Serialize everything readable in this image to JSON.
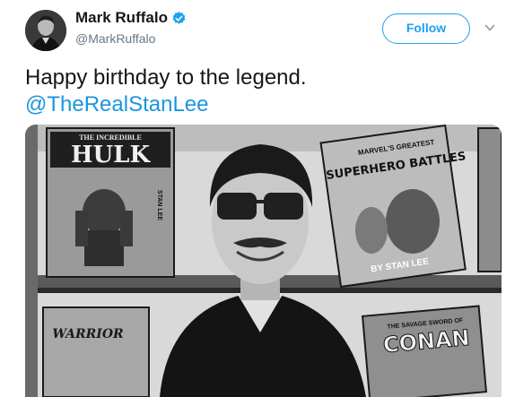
{
  "author": {
    "display_name": "Mark Ruffalo",
    "handle": "@MarkRuffalo",
    "verified": true
  },
  "actions": {
    "follow_label": "Follow",
    "menu_icon": "chevron-down-icon"
  },
  "tweet": {
    "text": "Happy birthday to the legend.",
    "mention": "@TheRealStanLee"
  },
  "media": {
    "comic_hulk_header": "THE INCREDIBLE",
    "comic_hulk_title": "HULK",
    "comic_hulk_side": "STAN LEE",
    "comic_battles_header": "MARVEL'S GREATEST",
    "comic_battles_title": "SUPERHERO BATTLES",
    "comic_battles_footer": "BY STAN LEE",
    "comic_conan_header": "THE SAVAGE SWORD OF",
    "comic_conan_title": "CONAN",
    "comic_warrior_title": "WARRIOR"
  },
  "colors": {
    "accent": "#1da1f2",
    "link": "#1b95e0",
    "text": "#14171a",
    "secondary": "#657786"
  }
}
